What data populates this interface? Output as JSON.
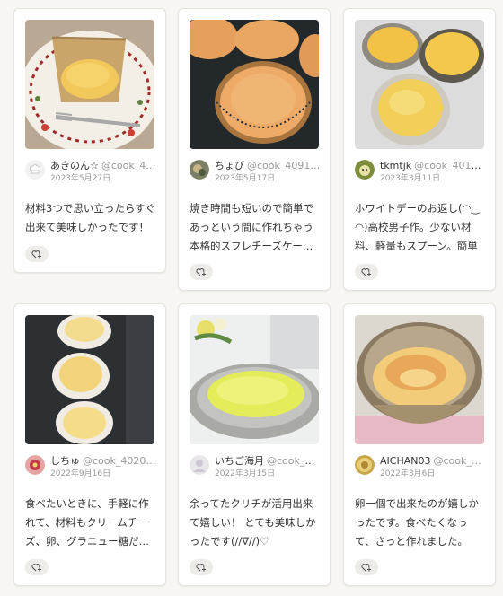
{
  "cards": [
    {
      "name": "あきのん☆",
      "handle": "@cook_4…",
      "date": "2023年5月27日",
      "comment": "材料3つで思い立ったらすぐ出来て美味しかったです！",
      "avatar_icon": "chef-hat-icon",
      "photo_icon": "cheesecake-cup-photo"
    },
    {
      "name": "ちょび",
      "handle": "@cook_4091…",
      "date": "2023年5月17日",
      "comment": "焼き時間も短いので簡単であっという間に作れちゃう本格的スフレチーズケー…",
      "avatar_icon": "user-avatar-icon",
      "photo_icon": "souffle-cheesecakes-photo"
    },
    {
      "name": "tkmtjk",
      "handle": "@cook_4010…",
      "date": "2023年3月11日",
      "comment": "ホワイトデーのお返し(◠‿◠)高校男子作。少ない材料、軽量もスプーン。簡単で…",
      "avatar_icon": "user-avatar-icon",
      "photo_icon": "baked-cups-photo"
    },
    {
      "name": "しちゅ",
      "handle": "@cook_4020…",
      "date": "2022年9月16日",
      "comment": "食べたいときに、手軽に作れて、材料もクリームチーズ、卵、グラニュー糖だ…",
      "avatar_icon": "user-avatar-icon",
      "photo_icon": "ramekins-photo"
    },
    {
      "name": "いちご海月",
      "handle": "@cook_4…",
      "date": "2022年3月15日",
      "comment": "余ってたクリチが活用出来て嬉しい！ とても美味しかったです(//∇//)♡",
      "avatar_icon": "user-avatar-icon",
      "photo_icon": "gratin-dish-photo"
    },
    {
      "name": "AICHAN03",
      "handle": "@cook_…",
      "date": "2022年3月6日",
      "comment": "卵一個で出来たのが嬉しかったです。食べたくなって、さっと作れました。",
      "avatar_icon": "user-avatar-icon",
      "photo_icon": "bowl-souffle-photo"
    }
  ],
  "like_icon": "heart-plus-icon",
  "colors": {
    "accent_red": "#c23b22",
    "chip_bg": "#eeece8"
  }
}
